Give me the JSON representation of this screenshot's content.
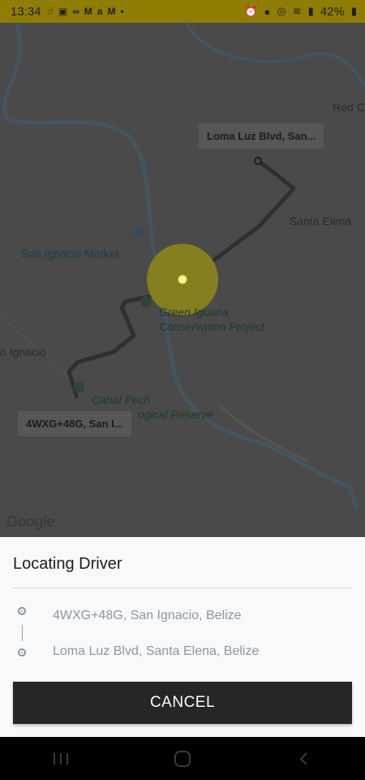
{
  "status_bar": {
    "time": "13:34",
    "left_icons": [
      "hand-icon",
      "app-icon",
      "voicemail-icon",
      "gmail-icon",
      "airtel-icon",
      "gmail-icon",
      "dot-icon"
    ],
    "battery": "42%"
  },
  "map": {
    "labels": {
      "red_c": "Red C",
      "santa_elena": "Santa Elena",
      "san_ignacio_market": "San Ignacio Market",
      "iguana_1": "Green Iguana",
      "iguana_2": "Conservation Project",
      "n_ignacio": "n Ignacio",
      "cahal_pech": "Cahal Pech",
      "reserve": "ogical Reserve"
    },
    "dest_chip": "Loma Luz Blvd, San...",
    "origin_chip": "4WXG+48G, San I...",
    "logo": "Google",
    "accent_color": "#e8df2a"
  },
  "sheet": {
    "title": "Locating Driver",
    "origin": "4WXG+48G, San Ignacio, Belize",
    "destination": "Loma Luz Blvd, Santa Elena, Belize",
    "cancel_label": "CANCEL"
  }
}
